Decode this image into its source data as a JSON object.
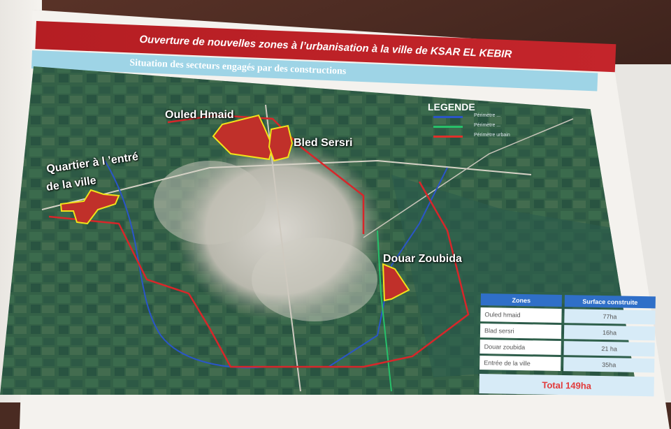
{
  "header": {
    "title": "Ouverture de nouvelles zones à l’urbanisation à la ville de KSAR EL KEBIR",
    "subtitle": "Situation des secteurs engagés par des constructions"
  },
  "map": {
    "zone_labels": {
      "ouled_hmaid": "Ouled Hmaid",
      "bled_sersri": "Bled Sersri",
      "quartier_line1": "Quartier à l ’entré",
      "quartier_line2": "de la ville",
      "douar_zoubida": "Douar Zoubida"
    },
    "colors": {
      "zone_fill": "#c0302a",
      "zone_outline": "#f2e21a",
      "perimeter_urbain": "#d8262a",
      "perimeter_blue": "#2a55c8",
      "perimeter_green": "#27c06a"
    }
  },
  "legend": {
    "title": "LEGENDE",
    "items": [
      {
        "label": "Périmètre ...",
        "color": "#2a55c8"
      },
      {
        "label": "Périmètre ...",
        "color": "#27c06a"
      },
      {
        "label": "Périmètre urbain",
        "color": "#e0302a"
      }
    ]
  },
  "table": {
    "headers": [
      "Zones",
      "Surface construite"
    ],
    "rows": [
      {
        "zone": "Ouled hmaid",
        "surface": "77ha"
      },
      {
        "zone": "Blad sersri",
        "surface": "16ha"
      },
      {
        "zone": "Douar zoubida",
        "surface": "21 ha"
      },
      {
        "zone": "Entrée de la ville",
        "surface": "35ha"
      }
    ],
    "total": "Total  149ha"
  }
}
